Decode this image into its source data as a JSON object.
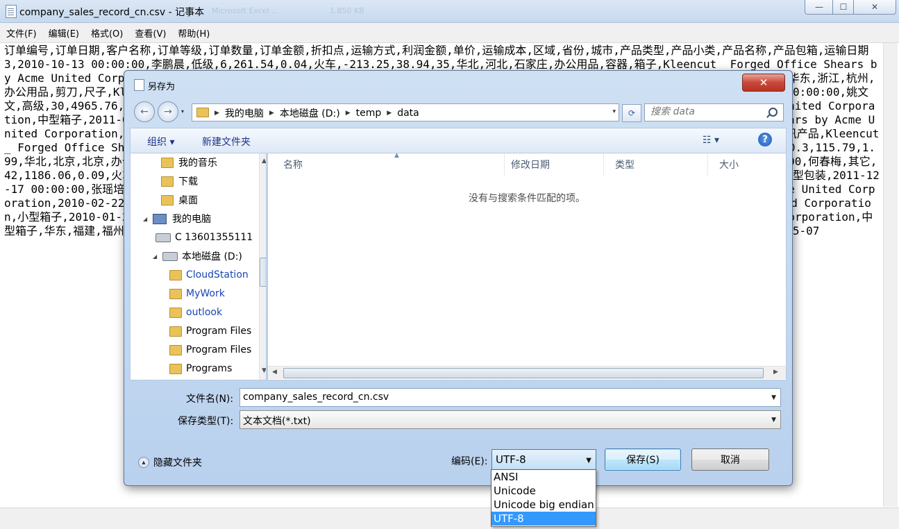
{
  "notepad": {
    "title": "company_sales_record_cn.csv - 记事本",
    "ghost_title": "Microsoft Excel ...",
    "ghost_size": "1,850 KB",
    "controls": {
      "minimize": "—",
      "maximize": "☐",
      "close": "✕"
    },
    "menu": [
      "文件(F)",
      "编辑(E)",
      "格式(O)",
      "查看(V)",
      "帮助(H)"
    ],
    "content": "订单编号,订单日期,客户名称,订单等级,订单数量,订单金额,折扣点,运输方式,利润金额,单价,运输成本,区域,省份,城市,产品类型,产品小类,产品名称,产品包箱,运输日期3,2010-10-13 00:00:00,李鹏晨,低级,6,261.54,0.04,火车,-213.25,38.94,35,华北,河北,石家庄,办公用品,容器,箱子,Kleencut_ Forged Office Shears by Acme United Corporation,大型箱子,2010-10-20 00:00:00,293,2012-10-01 00:00:00,王勇民,其它,2,6,0.01,火车,-4.36,1.99,1.56,华东,浙江,杭州,办公用品,剪刀,尺子,Kleencut_ Forged Office Shears by Acme United Corporation,小型包装,2012-10-02 00:00:00,483,2011-07-10 00:00:00,姚文文,高级,30,4965.76,0.08,大卡,1198.97,195.99,3.99,华南,广东,汕头,家具产品,办公装饰品,Kleencut_ Forged Office Shears by Acme United Corporation,中型箱子,2011-07-15 00:00:00,姚文文,高级,12,85.13,7.99,5.03,华南,广东,汕头,技术产品,电脑配件,Kleencut_ Forged Office Shears by Acme United Corporation,中型箱子,2011-07-17 00:00:00,高亮平,其它,30,288.56,0.03,大卡,60.72,9.48,7.29,华南,湖北,武汉,技术产品,电话通讯产品,Kleencut_ Forged Office Shears by Acme United Corporation,打包纸,2011-11-01 00:00:00,1136,2011-11-02 00:00:00,张国华,中级,41,1470.3,115.79,1.99,华北,北京,北京,办公用品,笔、美术用品,Kleencut_ Forged Office Shears by Acme United Corporation,小型包裹,2011-03-18 00:00:00,何春梅,其它,42,1186.06,0.09,火车,-127.17,5.99,华东,福建,福州,办公用品,纸张,Kleencut_ Forged Office Shears by Acme United Corporation,小型包装,2011-12-17 00:00:00,张瑶培,低级,26,75.57,0.03,火车,9.96,5.99,5.99,华北,北京,\"北京 \",技术产品,Kleencut_ Forged Office Shears by Acme United Corporation,2010-02-22 00:00:00,96,2009-04-16 00:00:00,刘晓,中级,26,75.57,0.03,Kleencut_ Forged Office Shears by Acme United Corporation,小型箱子,2010-01-29 00:00:00,张宏波,高级,3,461.89,0.05,大卡,办公用品,纸张,Kleencut_ Forged Office Shears by Acme United Corporation,中型箱子,华东,福建,福州,办公用品,纸张,Kleencut_ Forged Office Shears by Acme United Corporation,2012-05-08 00:00:00130,2012-05-07"
  },
  "dialog": {
    "title": "另存为",
    "close_label": "✕",
    "nav_back": "←",
    "nav_forward": "→",
    "nav_history": "▾",
    "breadcrumbs": [
      "我的电脑",
      "本地磁盘 (D:)",
      "temp",
      "data"
    ],
    "breadcrumb_sep": "▶",
    "search_placeholder": "搜索 data",
    "refresh_icon": "⟳",
    "toolbar": {
      "organize": "组织 ▾",
      "new_folder": "新建文件夹",
      "view_icon": "☷ ▾",
      "help": "?"
    },
    "tree": [
      {
        "label": "我的音乐",
        "icon": "music-folder-icon"
      },
      {
        "label": "下载",
        "icon": "downloads-folder-icon"
      },
      {
        "label": "桌面",
        "icon": "desktop-folder-icon"
      },
      {
        "label": "我的电脑",
        "icon": "computer-icon"
      },
      {
        "label": "C 13601355111",
        "icon": "drive-c-icon"
      },
      {
        "label": "本地磁盘 (D:)",
        "icon": "drive-d-icon"
      },
      {
        "label": "CloudStation",
        "icon": "cloud-folder-icon"
      },
      {
        "label": "MyWork",
        "icon": "folder-icon"
      },
      {
        "label": "outlook",
        "icon": "folder-icon"
      },
      {
        "label": "Program Files",
        "icon": "folder-icon"
      },
      {
        "label": "Program Files",
        "icon": "folder-icon"
      },
      {
        "label": "Programs",
        "icon": "folder-icon"
      }
    ],
    "columns": [
      "名称",
      "修改日期",
      "类型",
      "大小"
    ],
    "empty_message": "没有与搜索条件匹配的项。",
    "filename_label": "文件名(N):",
    "filename_value": "company_sales_record_cn.csv",
    "filetype_label": "保存类型(T):",
    "filetype_value": "文本文档(*.txt)",
    "hide_folders": "隐藏文件夹",
    "encoding_label": "编码(E):",
    "encoding_value": "UTF-8",
    "save_button": "保存(S)",
    "cancel_button": "取消",
    "encoding_options": [
      "ANSI",
      "Unicode",
      "Unicode big endian",
      "UTF-8"
    ],
    "colors": {
      "selection": "#3399ff",
      "link": "#1845b4",
      "close_button": "#c8483a"
    }
  }
}
